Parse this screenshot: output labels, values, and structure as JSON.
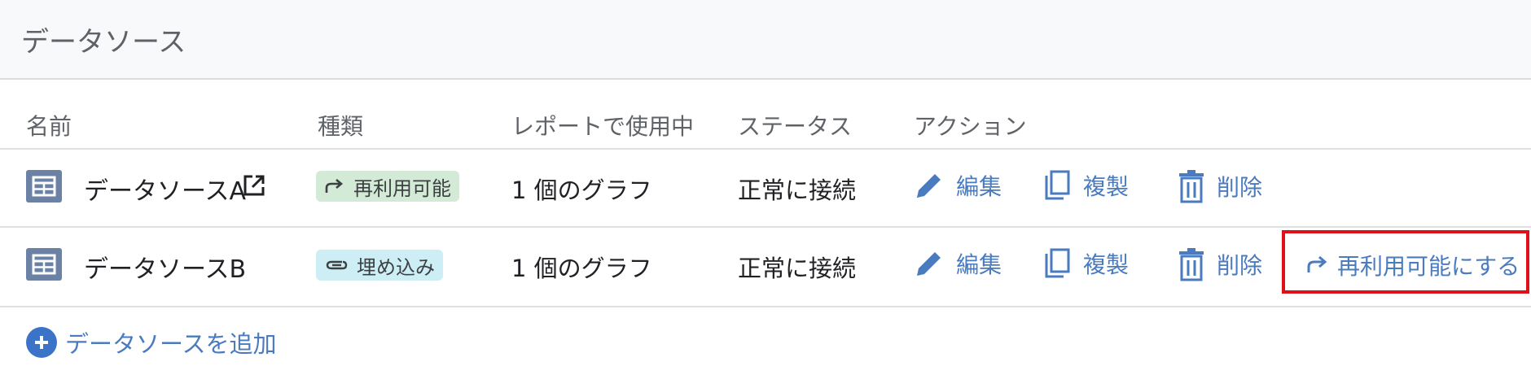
{
  "header": {
    "title": "データソース"
  },
  "columns": {
    "name": "名前",
    "type": "種類",
    "in_use": "レポートで使用中",
    "status": "ステータス",
    "actions": "アクション"
  },
  "rows": [
    {
      "name": "データソースA",
      "type_label": "再利用可能",
      "in_use": "1 個のグラフ",
      "status": "正常に接続",
      "edit": "編集",
      "duplicate": "複製",
      "delete": "削除"
    },
    {
      "name": "データソースB",
      "type_label": "埋め込み",
      "in_use": "1 個のグラフ",
      "status": "正常に接続",
      "edit": "編集",
      "duplicate": "複製",
      "delete": "削除",
      "make_reusable": "再利用可能にする"
    }
  ],
  "add_button": {
    "label": "データソースを追加"
  },
  "colors": {
    "accent": "#4a7bbf",
    "reuse_chip": "#d2ead6",
    "embed_chip": "#cdeef4",
    "highlight": "#e0101a",
    "table_icon": "#6b82a5"
  },
  "icons": {
    "table": "table-icon",
    "external": "open-in-new-icon",
    "reuse": "share-arrow-icon",
    "embed": "attachment-clip-icon",
    "edit": "pencil-icon",
    "duplicate": "copy-icon",
    "delete": "trash-icon",
    "add": "plus-circle-icon"
  }
}
